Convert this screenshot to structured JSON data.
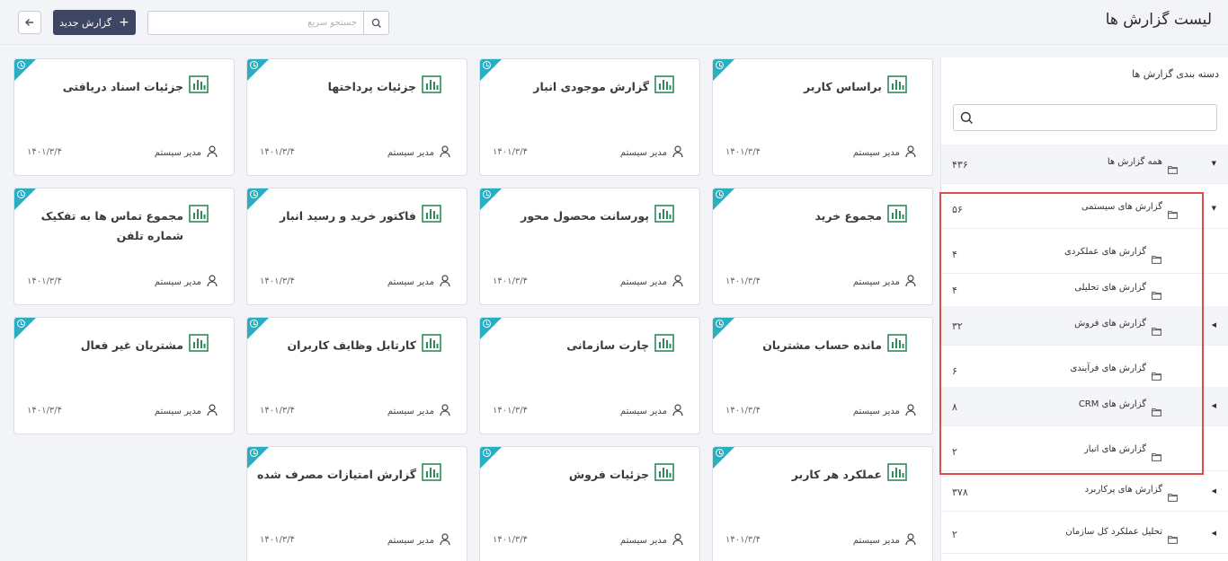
{
  "header": {
    "title": "لیست گزارش ها",
    "new_button": "گزارش جدید",
    "search_placeholder": "جستجو سریع",
    "back_icon": "arrow-left-icon",
    "search_icon": "search-icon"
  },
  "cards": [
    {
      "title": "براساس کاربر",
      "author": "مدیر سیستم",
      "date": "۱۴۰۱/۳/۴"
    },
    {
      "title": "گزارش موجودی انبار",
      "author": "مدیر سیستم",
      "date": "۱۴۰۱/۳/۴"
    },
    {
      "title": "جزئیات پرداختها",
      "author": "مدیر سیستم",
      "date": "۱۴۰۱/۳/۴"
    },
    {
      "title": "جزئیات اسناد دریافتی",
      "author": "مدیر سیستم",
      "date": "۱۴۰۱/۳/۴"
    },
    {
      "title": "مجموع خرید",
      "author": "مدیر سیستم",
      "date": "۱۴۰۱/۳/۴"
    },
    {
      "title": "پورسانت محصول محور",
      "author": "مدیر سیستم",
      "date": "۱۴۰۱/۳/۴"
    },
    {
      "title": "فاکتور خرید و رسید انبار",
      "author": "مدیر سیستم",
      "date": "۱۴۰۱/۳/۴"
    },
    {
      "title": "مجموع تماس ها به تفکیک شماره تلفن",
      "author": "مدیر سیستم",
      "date": "۱۴۰۱/۳/۴"
    },
    {
      "title": "مانده حساب مشتریان",
      "author": "مدیر سیستم",
      "date": "۱۴۰۱/۳/۴"
    },
    {
      "title": "چارت سازمانی",
      "author": "مدیر سیستم",
      "date": "۱۴۰۱/۳/۴"
    },
    {
      "title": "کارتابل وظایف کاربران",
      "author": "مدیر سیستم",
      "date": "۱۴۰۱/۳/۴"
    },
    {
      "title": "مشتریان غیر فعال",
      "author": "مدیر سیستم",
      "date": "۱۴۰۱/۳/۴"
    },
    {
      "title": "عملکرد هر کاربر",
      "author": "مدیر سیستم",
      "date": "۱۴۰۱/۳/۴"
    },
    {
      "title": "جزئیات فروش",
      "author": "مدیر سیستم",
      "date": "۱۴۰۱/۳/۴"
    },
    {
      "title": "گزارش امتیازات مصرف شده",
      "author": "مدیر سیستم",
      "date": "۱۴۰۱/۳/۴"
    }
  ],
  "sidebar": {
    "title": "دسته بندی گزارش ها",
    "tree": [
      {
        "label": "همه گزارش ها",
        "count": "۴۳۶",
        "caret": "▼"
      },
      {
        "label": "گزارش های سیستمی",
        "count": "۵۶",
        "caret": "▼"
      },
      {
        "label": "گزارش های عملکردی",
        "count": "۴",
        "caret": ""
      },
      {
        "label": "گزارش های تحلیلی",
        "count": "۴",
        "caret": ""
      },
      {
        "label": "گزارش های فروش",
        "count": "۳۲",
        "caret": "◀"
      },
      {
        "label": "گزارش های فرآیندی",
        "count": "۶",
        "caret": ""
      },
      {
        "label": "گزارش های CRM",
        "count": "۸",
        "caret": "◀"
      },
      {
        "label": "گزارش های انبار",
        "count": "۲",
        "caret": ""
      },
      {
        "label": "گزارش های پرکاربرد",
        "count": "۳۷۸",
        "caret": "◀"
      },
      {
        "label": "تحلیل عملکرد کل سازمان",
        "count": "۲",
        "caret": "◀"
      }
    ]
  },
  "colors": {
    "accent": "#2aaec1",
    "chart_icon": "#2d8a5b",
    "button": "#3d4663",
    "highlight": "#e04b4b"
  }
}
